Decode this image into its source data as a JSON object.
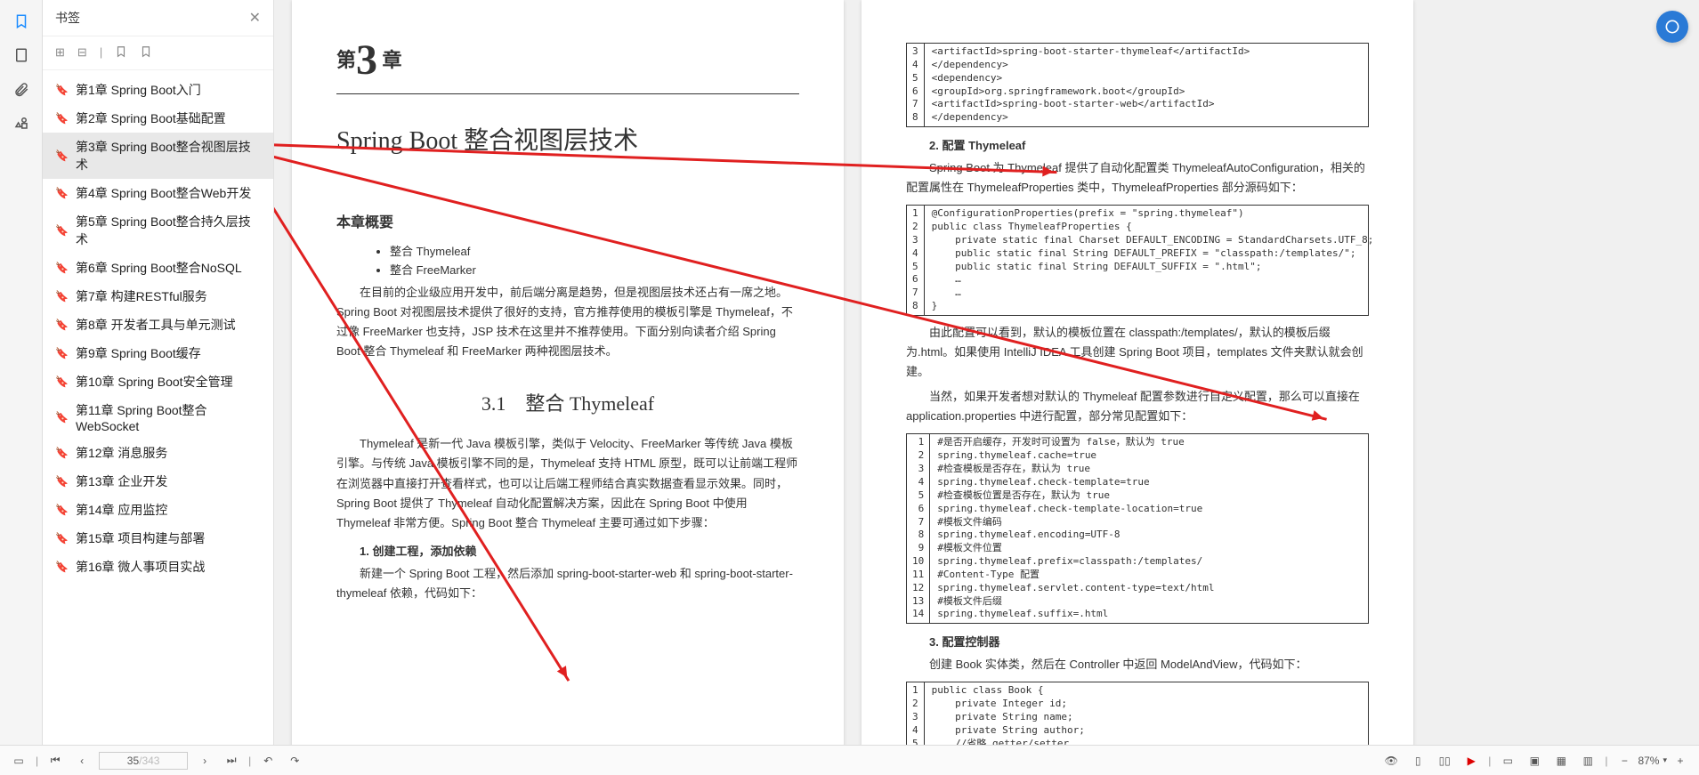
{
  "sidepanel": {
    "title": "书签",
    "items": [
      {
        "label": "第1章 Spring Boot入门"
      },
      {
        "label": "第2章 Spring Boot基础配置"
      },
      {
        "label": "第3章 Spring Boot整合视图层技术",
        "active": true
      },
      {
        "label": "第4章 Spring Boot整合Web开发"
      },
      {
        "label": "第5章 Spring Boot整合持久层技术"
      },
      {
        "label": "第6章 Spring Boot整合NoSQL"
      },
      {
        "label": "第7章 构建RESTful服务"
      },
      {
        "label": "第8章 开发者工具与单元测试"
      },
      {
        "label": "第9章 Spring Boot缓存"
      },
      {
        "label": "第10章 Spring Boot安全管理"
      },
      {
        "label": "第11章 Spring Boot整合WebSocket"
      },
      {
        "label": "第12章 消息服务"
      },
      {
        "label": "第13章 企业开发"
      },
      {
        "label": "第14章 应用监控"
      },
      {
        "label": "第15章 项目构建与部署"
      },
      {
        "label": "第16章 微人事项目实战"
      }
    ]
  },
  "pageLeft": {
    "chapterPre": "第",
    "chapterNum": "3",
    "chapterPost": " 章",
    "title": "Spring Boot 整合视图层技术",
    "overview_h": "本章概要",
    "bullets": [
      "整合 Thymeleaf",
      "整合 FreeMarker"
    ],
    "p1": "在目前的企业级应用开发中，前后端分离是趋势，但是视图层技术还占有一席之地。Spring Boot 对视图层技术提供了很好的支持，官方推荐使用的模板引擎是 Thymeleaf，不过像 FreeMarker 也支持，JSP 技术在这里并不推荐使用。下面分别向读者介绍 Spring Boot 整合 Thymeleaf 和 FreeMarker 两种视图层技术。",
    "sec31": "3.1　整合 Thymeleaf",
    "p2": "Thymeleaf 是新一代 Java 模板引擎，类似于 Velocity、FreeMarker 等传统 Java 模板引擎。与传统 Java 模板引擎不同的是，Thymeleaf 支持 HTML 原型，既可以让前端工程师在浏览器中直接打开查看样式，也可以让后端工程师结合真实数据查看显示效果。同时，Spring Boot 提供了 Thymeleaf 自动化配置解决方案，因此在 Spring Boot 中使用 Thymeleaf 非常方便。Spring Boot 整合 Thymeleaf 主要可通过如下步骤：",
    "step1_h": "1. 创建工程，添加依赖",
    "step1_p": "新建一个 Spring Boot 工程，然后添加 spring-boot-starter-web 和 spring-boot-starter-thymeleaf 依赖，代码如下："
  },
  "pageRight": {
    "code1": {
      "start": 3,
      "lines": [
        "<artifactId>spring-boot-starter-thymeleaf</artifactId>",
        "</dependency>",
        "<dependency>",
        "<groupId>org.springframework.boot</groupId>",
        "<artifactId>spring-boot-starter-web</artifactId>",
        "</dependency>"
      ]
    },
    "h2": "2. 配置 Thymeleaf",
    "p_cfg": "Spring Boot 为 Thymeleaf 提供了自动化配置类 ThymeleafAutoConfiguration，相关的配置属性在 ThymeleafProperties 类中，ThymeleafProperties 部分源码如下：",
    "code2": {
      "start": 1,
      "lines": [
        "@ConfigurationProperties(prefix = \"spring.thymeleaf\")",
        "public class ThymeleafProperties {",
        "    private static final Charset DEFAULT_ENCODING = StandardCharsets.UTF_8;",
        "    public static final String DEFAULT_PREFIX = \"classpath:/templates/\";",
        "    public static final String DEFAULT_SUFFIX = \".html\";",
        "    …",
        "    …",
        "}"
      ]
    },
    "p_loc": "由此配置可以看到，默认的模板位置在 classpath:/templates/，默认的模板后缀为.html。如果使用 IntelliJ IDEA 工具创建 Spring Boot 项目，templates 文件夹默认就会创建。",
    "p_custom": "当然，如果开发者想对默认的 Thymeleaf 配置参数进行自定义配置，那么可以直接在 application.properties 中进行配置，部分常见配置如下：",
    "code3": {
      "start": 1,
      "lines": [
        "#是否开启缓存，开发时可设置为 false，默认为 true",
        "spring.thymeleaf.cache=true",
        "#检查模板是否存在，默认为 true",
        "spring.thymeleaf.check-template=true",
        "#检查模板位置是否存在，默认为 true",
        "spring.thymeleaf.check-template-location=true",
        "#模板文件编码",
        "spring.thymeleaf.encoding=UTF-8",
        "#模板文件位置",
        "spring.thymeleaf.prefix=classpath:/templates/",
        "#Content-Type 配置",
        "spring.thymeleaf.servlet.content-type=text/html",
        "#模板文件后缀",
        "spring.thymeleaf.suffix=.html"
      ]
    },
    "h3": "3. 配置控制器",
    "p_ctrl": "创建 Book 实体类，然后在 Controller 中返回 ModelAndView，代码如下：",
    "code4": {
      "start": 1,
      "lines": [
        "public class Book {",
        "    private Integer id;",
        "    private String name;",
        "    private String author;",
        "    //省略 getter/setter"
      ]
    }
  },
  "footer": {
    "page_current": "35",
    "page_total": "/343",
    "zoom": "87%"
  }
}
